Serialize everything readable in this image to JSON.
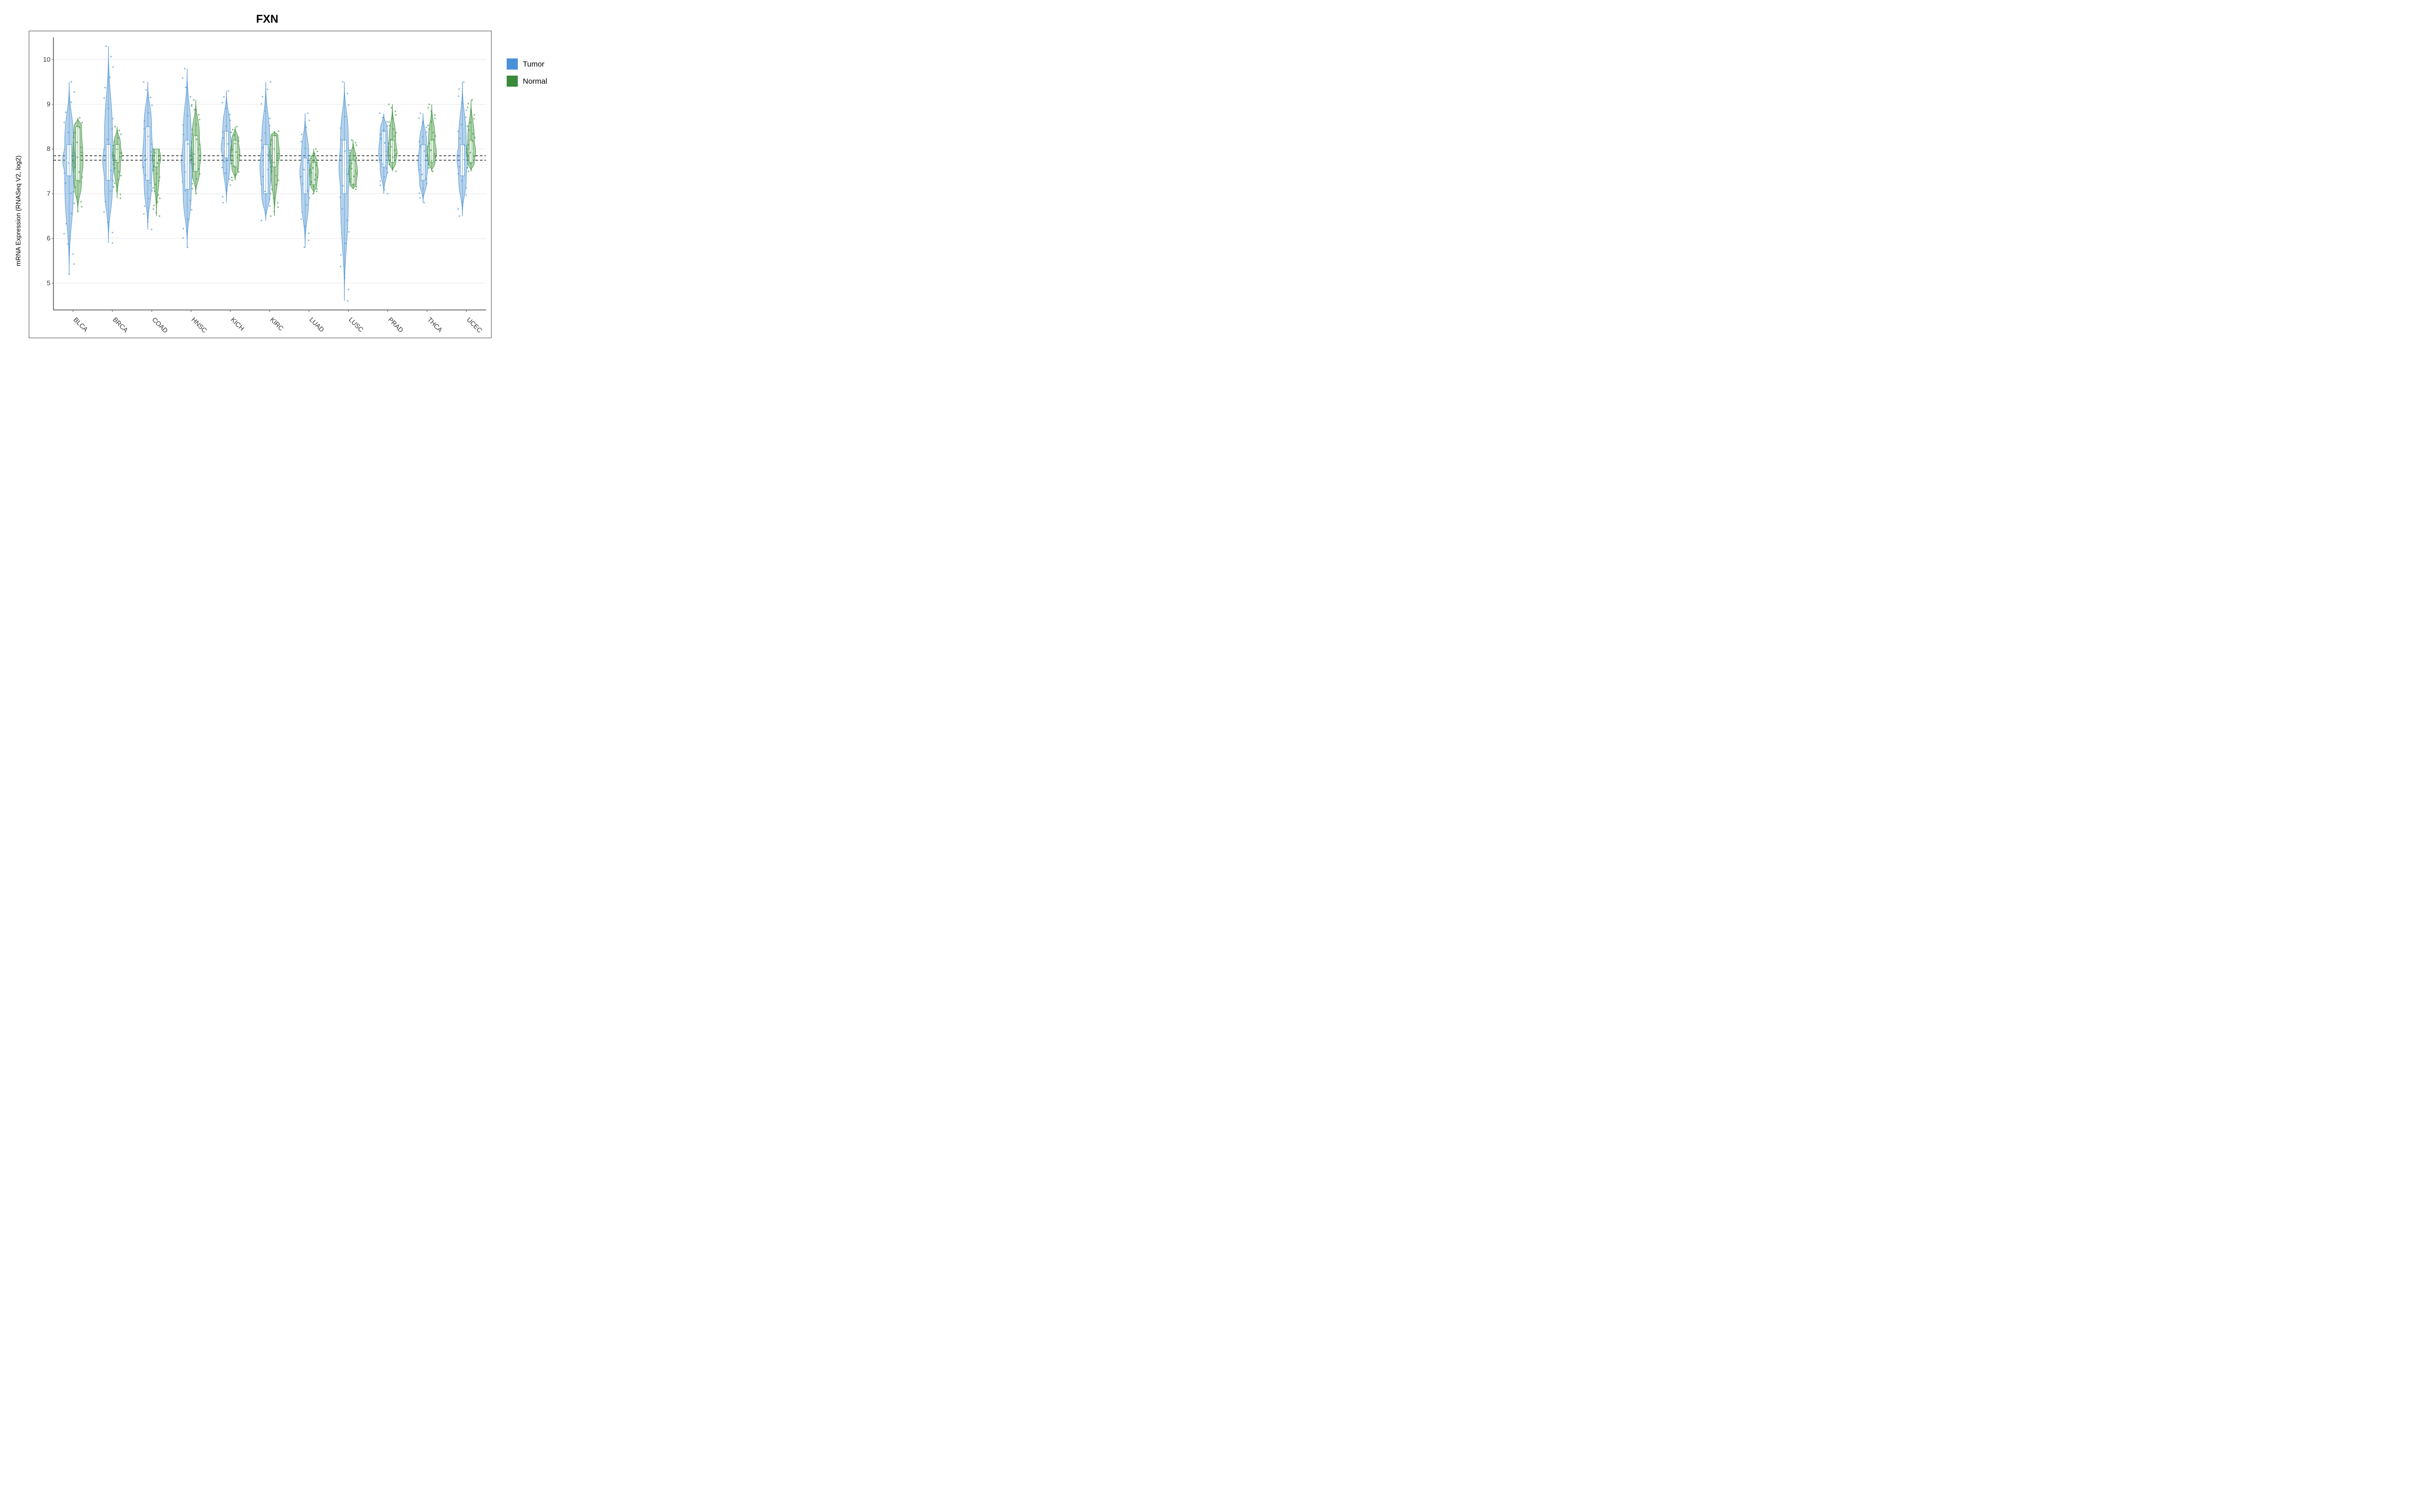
{
  "title": "FXN",
  "yAxisLabel": "mRNA Expression (RNASeq V2, log2)",
  "yTicks": [
    5,
    6,
    7,
    8,
    9,
    10
  ],
  "xLabels": [
    "BLCA",
    "BRCA",
    "COAD",
    "HNSC",
    "KICH",
    "KIRC",
    "LUAD",
    "LUSC",
    "PRAD",
    "THCA",
    "UCEC"
  ],
  "legend": {
    "items": [
      {
        "label": "Tumor",
        "color": "#4a90d9"
      },
      {
        "label": "Normal",
        "color": "#3a8a3a"
      }
    ]
  },
  "colors": {
    "tumor": "#5b9bd5",
    "normal": "#4a9a4a",
    "tumorLight": "#a8c8e8",
    "normalLight": "#7fc47f"
  },
  "refLines": [
    7.75,
    7.85
  ],
  "violins": [
    {
      "cancer": "BLCA",
      "tumor": {
        "center": 7.75,
        "q1": 7.4,
        "q3": 8.1,
        "min": 5.2,
        "max": 9.5,
        "width": 0.6
      },
      "normal": {
        "center": 7.7,
        "q1": 7.3,
        "q3": 8.5,
        "min": 6.6,
        "max": 8.7,
        "width": 0.5
      }
    },
    {
      "cancer": "BRCA",
      "tumor": {
        "center": 7.75,
        "q1": 7.3,
        "q3": 8.1,
        "min": 5.9,
        "max": 10.3,
        "width": 0.55
      },
      "normal": {
        "center": 7.85,
        "q1": 7.7,
        "q3": 8.1,
        "min": 6.9,
        "max": 8.5,
        "width": 0.45
      }
    },
    {
      "cancer": "COAD",
      "tumor": {
        "center": 7.7,
        "q1": 7.3,
        "q3": 8.5,
        "min": 6.2,
        "max": 9.5,
        "width": 0.5
      },
      "normal": {
        "center": 7.8,
        "q1": 7.6,
        "q3": 8.0,
        "min": 6.5,
        "max": 8.0,
        "width": 0.4
      }
    },
    {
      "cancer": "HNSC",
      "tumor": {
        "center": 7.7,
        "q1": 7.1,
        "q3": 8.2,
        "min": 5.8,
        "max": 9.8,
        "width": 0.55
      },
      "normal": {
        "center": 7.85,
        "q1": 7.5,
        "q3": 8.3,
        "min": 7.0,
        "max": 9.1,
        "width": 0.48
      }
    },
    {
      "cancer": "KICH",
      "tumor": {
        "center": 8.0,
        "q1": 7.8,
        "q3": 8.4,
        "min": 6.8,
        "max": 9.3,
        "width": 0.5
      },
      "normal": {
        "center": 7.9,
        "q1": 7.6,
        "q3": 8.2,
        "min": 7.3,
        "max": 8.5,
        "width": 0.45
      }
    },
    {
      "cancer": "KIRC",
      "tumor": {
        "center": 7.6,
        "q1": 7.0,
        "q3": 8.1,
        "min": 6.4,
        "max": 9.5,
        "width": 0.55
      },
      "normal": {
        "center": 7.85,
        "q1": 7.6,
        "q3": 8.3,
        "min": 6.5,
        "max": 8.4,
        "width": 0.48
      }
    },
    {
      "cancer": "LUAD",
      "tumor": {
        "center": 7.5,
        "q1": 7.0,
        "q3": 7.8,
        "min": 5.8,
        "max": 8.8,
        "width": 0.5
      },
      "normal": {
        "center": 7.5,
        "q1": 7.2,
        "q3": 7.7,
        "min": 7.0,
        "max": 8.0,
        "width": 0.42
      }
    },
    {
      "cancer": "LUSC",
      "tumor": {
        "center": 7.6,
        "q1": 7.0,
        "q3": 8.2,
        "min": 4.6,
        "max": 9.5,
        "width": 0.52
      },
      "normal": {
        "center": 7.5,
        "q1": 7.2,
        "q3": 7.75,
        "min": 7.1,
        "max": 8.2,
        "width": 0.42
      }
    },
    {
      "cancer": "PRAD",
      "tumor": {
        "center": 7.9,
        "q1": 7.6,
        "q3": 8.4,
        "min": 7.0,
        "max": 8.8,
        "width": 0.48
      },
      "normal": {
        "center": 7.9,
        "q1": 7.7,
        "q3": 8.2,
        "min": 7.5,
        "max": 9.0,
        "width": 0.44
      }
    },
    {
      "cancer": "THCA",
      "tumor": {
        "center": 7.7,
        "q1": 7.3,
        "q3": 8.1,
        "min": 6.8,
        "max": 8.8,
        "width": 0.48
      },
      "normal": {
        "center": 7.9,
        "q1": 7.7,
        "q3": 8.2,
        "min": 7.5,
        "max": 9.0,
        "width": 0.44
      }
    },
    {
      "cancer": "UCEC",
      "tumor": {
        "center": 7.8,
        "q1": 7.4,
        "q3": 8.1,
        "min": 6.5,
        "max": 9.5,
        "width": 0.52
      },
      "normal": {
        "center": 7.95,
        "q1": 7.7,
        "q3": 8.2,
        "min": 7.5,
        "max": 9.1,
        "width": 0.44
      }
    }
  ]
}
